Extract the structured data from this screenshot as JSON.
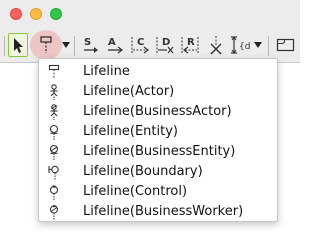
{
  "window": {
    "controls": [
      "close",
      "minimize",
      "maximize"
    ]
  },
  "toolbar": {
    "buttons": [
      {
        "name": "select-tool",
        "icon": "cursor-arrow-icon",
        "active": true
      },
      {
        "name": "lifeline-tool",
        "icon": "lifeline-icon",
        "highlighted": true
      },
      {
        "name": "lifeline-dropdown",
        "icon": "dropdown-triangle-icon"
      },
      {
        "name": "sync-message-tool",
        "icon": "sync-message-icon",
        "letter": "S"
      },
      {
        "name": "async-message-tool",
        "icon": "async-message-icon",
        "letter": "A"
      },
      {
        "name": "create-message-tool",
        "icon": "create-message-icon",
        "letter": "C"
      },
      {
        "name": "destroy-message-tool",
        "icon": "destroy-message-icon",
        "letter": "D"
      },
      {
        "name": "reply-message-tool",
        "icon": "reply-message-icon",
        "letter": "R"
      },
      {
        "name": "stop-tool",
        "icon": "stop-x-icon"
      },
      {
        "name": "duration-constraint-tool",
        "icon": "duration-constraint-icon"
      },
      {
        "name": "duration-dropdown",
        "icon": "dropdown-triangle-icon"
      },
      {
        "name": "frame-tool",
        "icon": "frame-icon"
      }
    ]
  },
  "menu": {
    "items": [
      {
        "label": "Lifeline",
        "icon": "lifeline-icon"
      },
      {
        "label": "Lifeline(Actor)",
        "icon": "actor-icon"
      },
      {
        "label": "Lifeline(BusinessActor)",
        "icon": "business-actor-icon"
      },
      {
        "label": "Lifeline(Entity)",
        "icon": "entity-icon"
      },
      {
        "label": "Lifeline(BusinessEntity)",
        "icon": "business-entity-icon"
      },
      {
        "label": "Lifeline(Boundary)",
        "icon": "boundary-icon"
      },
      {
        "label": "Lifeline(Control)",
        "icon": "control-icon"
      },
      {
        "label": "Lifeline(BusinessWorker)",
        "icon": "business-worker-icon"
      }
    ]
  },
  "colors": {
    "halo": "#f09696",
    "select_border": "#8cc63f",
    "tool_green": "#3a8a1f"
  }
}
